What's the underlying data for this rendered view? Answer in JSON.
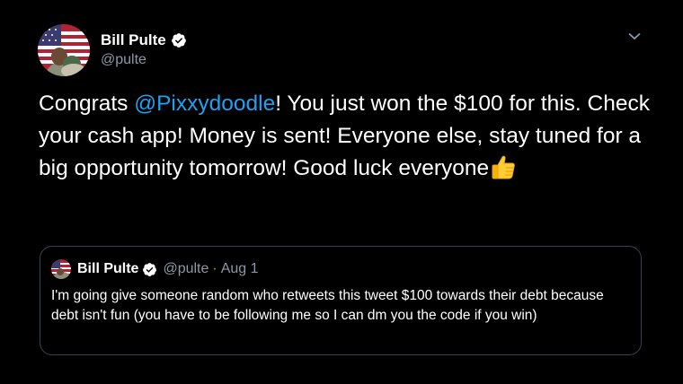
{
  "tweet": {
    "author_name": "Bill Pulte",
    "author_handle": "@pulte",
    "text_before": "Congrats ",
    "mention": "@Pixxydoodle",
    "text_after": "! You just won the $100 for this. Check your cash app! Money is sent! Everyone else, stay tuned for a big opportunity tomorrow!  Good luck everyone",
    "emoji_icon": "thumbs-up-icon",
    "menu_icon": "chevron-down-icon"
  },
  "quoted_tweet": {
    "author_name": "Bill Pulte",
    "author_handle": "@pulte",
    "date": "Aug 1",
    "separator": "·",
    "text": "I'm going give someone random who retweets this tweet $100 towards their debt because debt isn't fun (you have to be following me so I can dm you the code if you win)"
  },
  "colors": {
    "background": "#000000",
    "text": "#ffffff",
    "secondary_text": "#8b98a5",
    "link": "#1da1f2",
    "border": "#38444d",
    "verified_badge": "#ffffff"
  }
}
